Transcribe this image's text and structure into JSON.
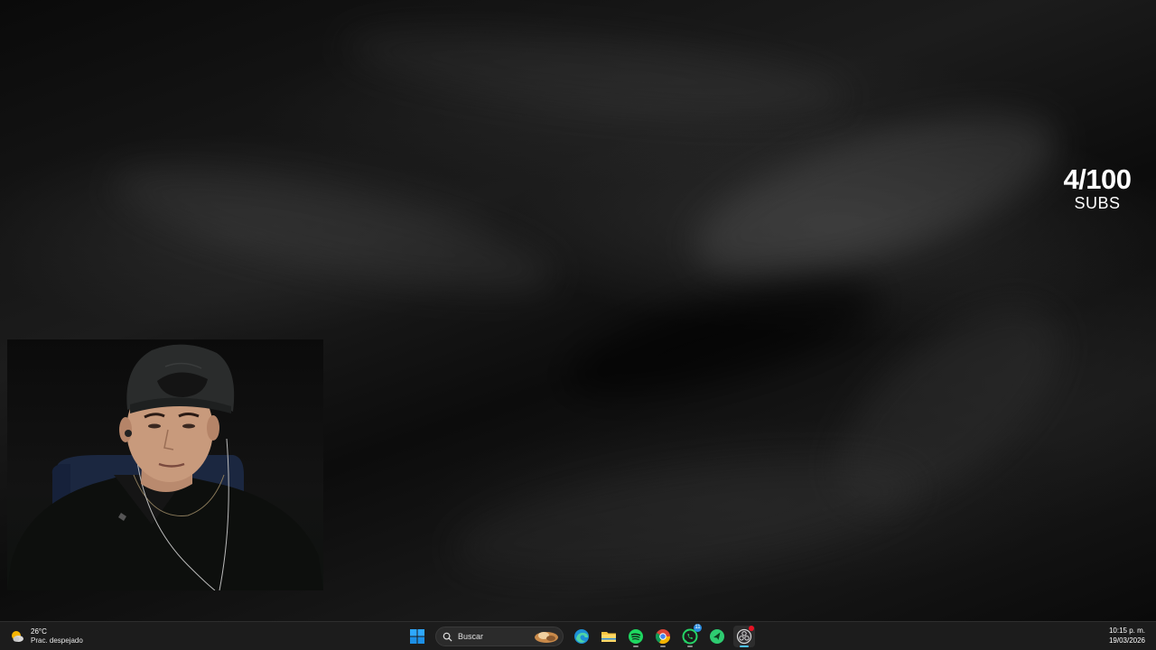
{
  "overlay": {
    "subs_count": "4/100",
    "subs_label": "SUBS"
  },
  "webcam": {
    "description_icon": "webcam-feed"
  },
  "taskbar": {
    "weather": {
      "icon": "partly-sunny-icon",
      "temperature": "26°C",
      "condition": "Prac. despejado"
    },
    "start": {
      "icon": "windows-start-icon"
    },
    "search": {
      "icon": "search-icon",
      "placeholder": "Buscar",
      "highlight_icon": "search-highlight-icon"
    },
    "apps": [
      {
        "name": "edge",
        "icon": "edge-icon"
      },
      {
        "name": "file-explorer",
        "icon": "folder-icon"
      },
      {
        "name": "spotify",
        "icon": "spotify-icon"
      },
      {
        "name": "chrome",
        "icon": "chrome-icon"
      },
      {
        "name": "whatsapp",
        "icon": "whatsapp-icon",
        "badge": "11"
      },
      {
        "name": "app-green-arrow",
        "icon": "green-arrow-icon"
      },
      {
        "name": "obs",
        "icon": "obs-icon"
      }
    ],
    "clock": {
      "time": "10:15 p. m.",
      "date": "19/03/2026"
    }
  },
  "colors": {
    "taskbar_bg": "#1c1c1c",
    "accent": "#4cc2ff",
    "text": "#ffffff"
  }
}
